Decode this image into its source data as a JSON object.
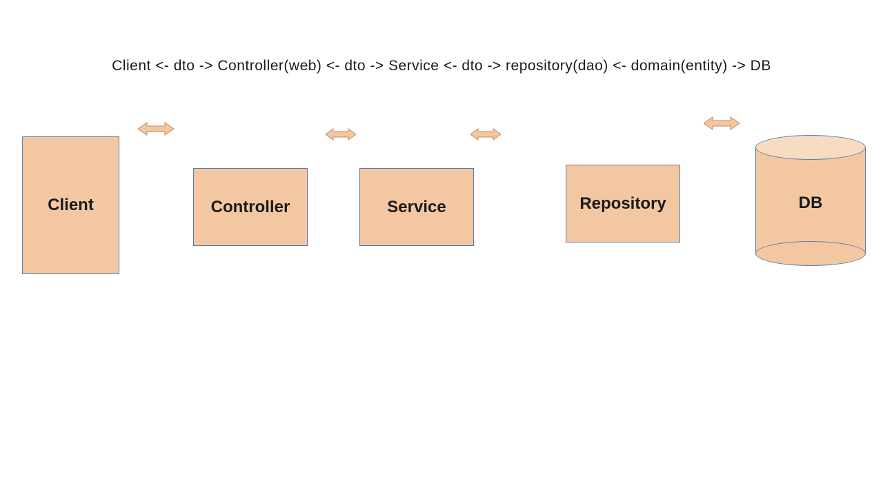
{
  "header": "Client  <- dto ->  Controller(web)  <- dto ->  Service  <- dto ->  repository(dao)  <- domain(entity) ->  DB",
  "boxes": {
    "client": "Client",
    "controller": "Controller",
    "service": "Service",
    "repository": "Repository",
    "db": "DB"
  },
  "colors": {
    "box_fill": "#f4c7a3",
    "box_border": "#5b7ca8",
    "db_top": "#f8dcc2",
    "arrow_fill": "#f4c7a3",
    "arrow_border": "#c08b5f"
  }
}
